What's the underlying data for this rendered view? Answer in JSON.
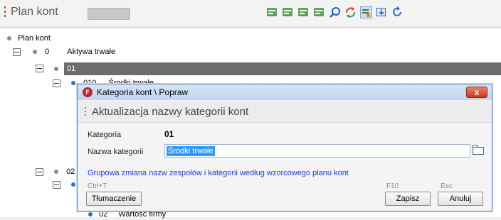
{
  "header": {
    "title": "Plan kont",
    "toolbar": [
      {
        "icon": "sort-ascending-icon"
      },
      {
        "icon": "sort-descending-icon"
      },
      {
        "icon": "list-expand-icon"
      },
      {
        "icon": "list-collapse-icon"
      },
      {
        "icon": "search-icon"
      },
      {
        "icon": "refresh-icon"
      },
      {
        "icon": "filter-icon"
      },
      {
        "icon": "export-icon"
      },
      {
        "icon": "reload-icon"
      }
    ]
  },
  "tree": {
    "root": "Plan kont",
    "nodes": [
      {
        "code": "0",
        "label": "Aktywa trwałe"
      },
      {
        "code": "01",
        "label": ""
      },
      {
        "code": "010",
        "label": "Środki trwałe"
      },
      {
        "code": "02",
        "label": ""
      },
      {
        "code": "02",
        "label": "Wartość firmy"
      }
    ]
  },
  "dialog": {
    "title": "Kategoria kont \\ Popraw",
    "close_label": "x",
    "heading": "Aktualizacja nazwy kategorii kont",
    "category_label": "Kategoria",
    "category_value": "01",
    "name_label": "Nazwa kategorii",
    "name_value": "Środki trwałe",
    "link_text": "Grupowa zmiana nazw zespołów i kategorii według wzorcowego planu kont",
    "translate": {
      "shortcut": "Ctrl+T",
      "label": "Tłumaczenie"
    },
    "save": {
      "shortcut": "F10",
      "label": "Zapisz"
    },
    "cancel": {
      "shortcut": "Esc",
      "label": "Anuluj"
    }
  },
  "colors": {
    "accent": "#2f6ec9",
    "selection": "#6d6d6d",
    "close": "#c5381c"
  }
}
